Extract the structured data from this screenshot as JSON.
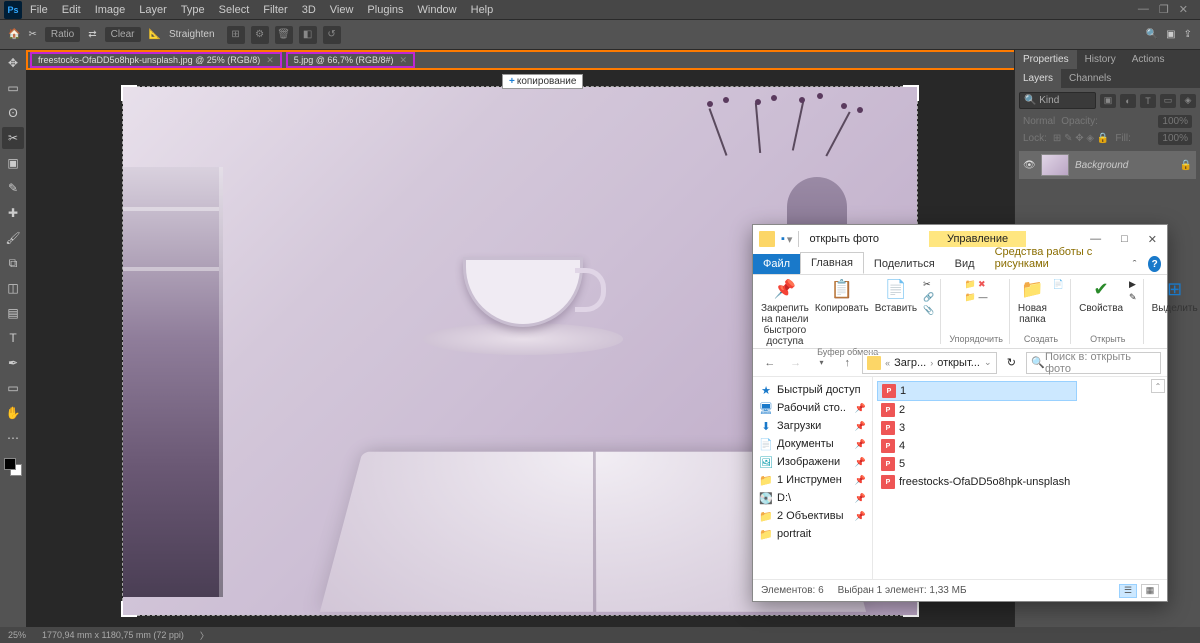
{
  "menu": {
    "items": [
      "File",
      "Edit",
      "Image",
      "Layer",
      "Type",
      "Select",
      "Filter",
      "3D",
      "View",
      "Plugins",
      "Window",
      "Help"
    ]
  },
  "options": {
    "ratio": "Ratio",
    "clear": "Clear",
    "straighten": "Straighten"
  },
  "tabs": {
    "active": "freestocks-OfaDD5o8hpk-unsplash.jpg @ 25% (RGB/8)",
    "inactive": "5.jpg @ 66,7% (RGB/8#)"
  },
  "tooltip": "копирование",
  "panels": {
    "tab_properties": "Properties",
    "tab_history": "History",
    "tab_actions": "Actions",
    "tab_layers": "Layers",
    "tab_channels": "Channels",
    "kind": "Kind",
    "blend": "Normal",
    "opacity_label": "Opacity:",
    "opacity_val": "100%",
    "lock_label": "Lock:",
    "fill_label": "Fill:",
    "fill_val": "100%",
    "layer_name": "Background"
  },
  "status": {
    "zoom": "25%",
    "dims": "1770,94 mm x 1180,75 mm (72 ppi)"
  },
  "explorer": {
    "title": "открыть фото",
    "manage": "Управление",
    "tab_file": "Файл",
    "tab_home": "Главная",
    "tab_share": "Поделиться",
    "tab_view": "Вид",
    "tab_pictools": "Средства работы с рисунками",
    "ribbon": {
      "pin_label": "Закрепить на панели быстрого доступа",
      "copy_label": "Копировать",
      "paste_label": "Вставить",
      "clipboard_group": "Буфер обмена",
      "organize_group": "Упорядочить",
      "newfolder_label": "Новая папка",
      "create_group": "Создать",
      "props_label": "Свойства",
      "open_group": "Открыть",
      "selectall_label": "Выделить"
    },
    "breadcrumbs": {
      "p1": "Загр...",
      "p2": "открыт..."
    },
    "search_placeholder": "Поиск в: открыть фото",
    "sidebar": {
      "quick": "Быстрый доступ",
      "desktop": "Рабочий сто..",
      "downloads": "Загрузки",
      "documents": "Документы",
      "pictures": "Изображени",
      "instruments": "1 Инструмен",
      "d_drive": "D:\\",
      "objective": "2 Объективы",
      "portrait": "portrait"
    },
    "files": [
      "1",
      "2",
      "3",
      "4",
      "5",
      "freestocks-OfaDD5o8hpk-unsplash"
    ],
    "status_count": "Элементов: 6",
    "status_sel": "Выбран 1 элемент: 1,33 МБ"
  }
}
